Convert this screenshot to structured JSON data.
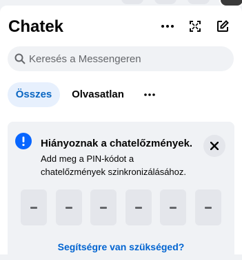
{
  "header": {
    "title": "Chatek",
    "icons": [
      "more-options-icon",
      "expand-icon",
      "new-message-icon"
    ]
  },
  "search": {
    "placeholder": "Keresés a Messengeren",
    "value": ""
  },
  "tabs": [
    {
      "label": "Összes",
      "active": true
    },
    {
      "label": "Olvasatlan",
      "active": false
    }
  ],
  "banner": {
    "title": "Hiányoznak a chatelőzmények.",
    "body": "Add meg a PIN-kódot a chatelőzmények szinkronizálásához.",
    "pin_boxes": 6,
    "help_link": "Segítségre van szükséged?"
  },
  "colors": {
    "accent": "#0a66c2",
    "info": "#0866ff",
    "link": "#0064d1"
  }
}
